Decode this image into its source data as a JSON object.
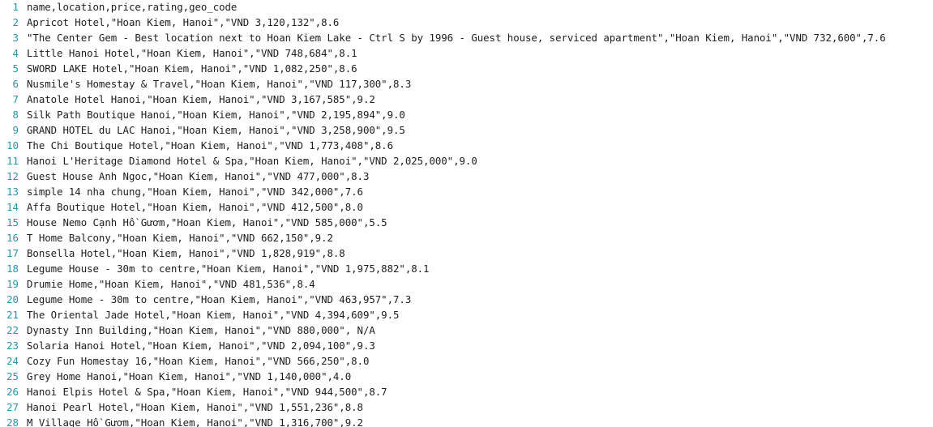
{
  "editor": {
    "lines": [
      {
        "num": "1",
        "text": "name,location,price,rating,geo_code"
      },
      {
        "num": "2",
        "text": "Apricot Hotel,\"Hoan Kiem, Hanoi\",\"VND 3,120,132\",8.6"
      },
      {
        "num": "3",
        "text": "\"The Center Gem - Best location next to Hoan Kiem Lake - Ctrl S by 1996 - Guest house, serviced apartment\",\"Hoan Kiem, Hanoi\",\"VND 732,600\",7.6"
      },
      {
        "num": "4",
        "text": "Little Hanoi Hotel,\"Hoan Kiem, Hanoi\",\"VND 748,684\",8.1"
      },
      {
        "num": "5",
        "text": "SWORD LAKE Hotel,\"Hoan Kiem, Hanoi\",\"VND 1,082,250\",8.6"
      },
      {
        "num": "6",
        "text": "Nusmile's Homestay & Travel,\"Hoan Kiem, Hanoi\",\"VND 117,300\",8.3"
      },
      {
        "num": "7",
        "text": "Anatole Hotel Hanoi,\"Hoan Kiem, Hanoi\",\"VND 3,167,585\",9.2"
      },
      {
        "num": "8",
        "text": "Silk Path Boutique Hanoi,\"Hoan Kiem, Hanoi\",\"VND 2,195,894\",9.0"
      },
      {
        "num": "9",
        "text": "GRAND HOTEL du LAC Hanoi,\"Hoan Kiem, Hanoi\",\"VND 3,258,900\",9.5"
      },
      {
        "num": "10",
        "text": "The Chi Boutique Hotel,\"Hoan Kiem, Hanoi\",\"VND 1,773,408\",8.6"
      },
      {
        "num": "11",
        "text": "Hanoi L'Heritage Diamond Hotel & Spa,\"Hoan Kiem, Hanoi\",\"VND 2,025,000\",9.0"
      },
      {
        "num": "12",
        "text": "Guest House Anh Ngoc,\"Hoan Kiem, Hanoi\",\"VND 477,000\",8.3"
      },
      {
        "num": "13",
        "text": "simple 14 nha chung,\"Hoan Kiem, Hanoi\",\"VND 342,000\",7.6"
      },
      {
        "num": "14",
        "text": "Affa Boutique Hotel,\"Hoan Kiem, Hanoi\",\"VND 412,500\",8.0"
      },
      {
        "num": "15",
        "text": "House Nemo Cạnh Hồ Gươm,\"Hoan Kiem, Hanoi\",\"VND 585,000\",5.5"
      },
      {
        "num": "16",
        "text": "T Home Balcony,\"Hoan Kiem, Hanoi\",\"VND 662,150\",9.2"
      },
      {
        "num": "17",
        "text": "Bonsella Hotel,\"Hoan Kiem, Hanoi\",\"VND 1,828,919\",8.8"
      },
      {
        "num": "18",
        "text": "Legume House - 30m to centre,\"Hoan Kiem, Hanoi\",\"VND 1,975,882\",8.1"
      },
      {
        "num": "19",
        "text": "Drumie Home,\"Hoan Kiem, Hanoi\",\"VND 481,536\",8.4"
      },
      {
        "num": "20",
        "text": "Legume Home - 30m to centre,\"Hoan Kiem, Hanoi\",\"VND 463,957\",7.3"
      },
      {
        "num": "21",
        "text": "The Oriental Jade Hotel,\"Hoan Kiem, Hanoi\",\"VND 4,394,609\",9.5"
      },
      {
        "num": "22",
        "text": "Dynasty Inn Building,\"Hoan Kiem, Hanoi\",\"VND 880,000\", N/A"
      },
      {
        "num": "23",
        "text": "Solaria Hanoi Hotel,\"Hoan Kiem, Hanoi\",\"VND 2,094,100\",9.3"
      },
      {
        "num": "24",
        "text": "Cozy Fun Homestay 16,\"Hoan Kiem, Hanoi\",\"VND 566,250\",8.0"
      },
      {
        "num": "25",
        "text": "Grey Home Hanoi,\"Hoan Kiem, Hanoi\",\"VND 1,140,000\",4.0"
      },
      {
        "num": "26",
        "text": "Hanoi Elpis Hotel & Spa,\"Hoan Kiem, Hanoi\",\"VND 944,500\",8.7"
      },
      {
        "num": "27",
        "text": "Hanoi Pearl Hotel,\"Hoan Kiem, Hanoi\",\"VND 1,551,236\",8.8"
      },
      {
        "num": "28",
        "text": "M Village Hồ Gươm,\"Hoan Kiem, Hanoi\",\"VND 1,316,700\",9.2"
      }
    ]
  },
  "colors": {
    "line_number": "#2b91af",
    "text": "#1e1e1e",
    "background": "#ffffff"
  }
}
